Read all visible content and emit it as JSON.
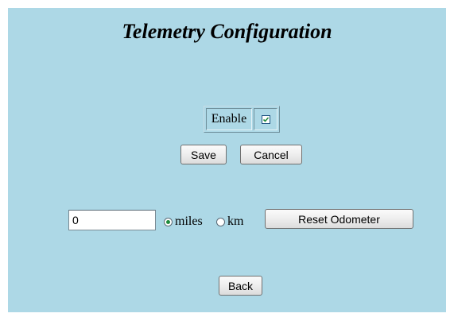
{
  "page": {
    "title": "Telemetry Configuration",
    "background_color": "#add8e6"
  },
  "enable": {
    "label": "Enable",
    "checked": true
  },
  "buttons": {
    "save": "Save",
    "cancel": "Cancel",
    "reset_odometer": "Reset Odometer",
    "back": "Back"
  },
  "odometer": {
    "value": "0",
    "units": [
      {
        "label": "miles",
        "selected": true
      },
      {
        "label": "km",
        "selected": false
      }
    ]
  }
}
